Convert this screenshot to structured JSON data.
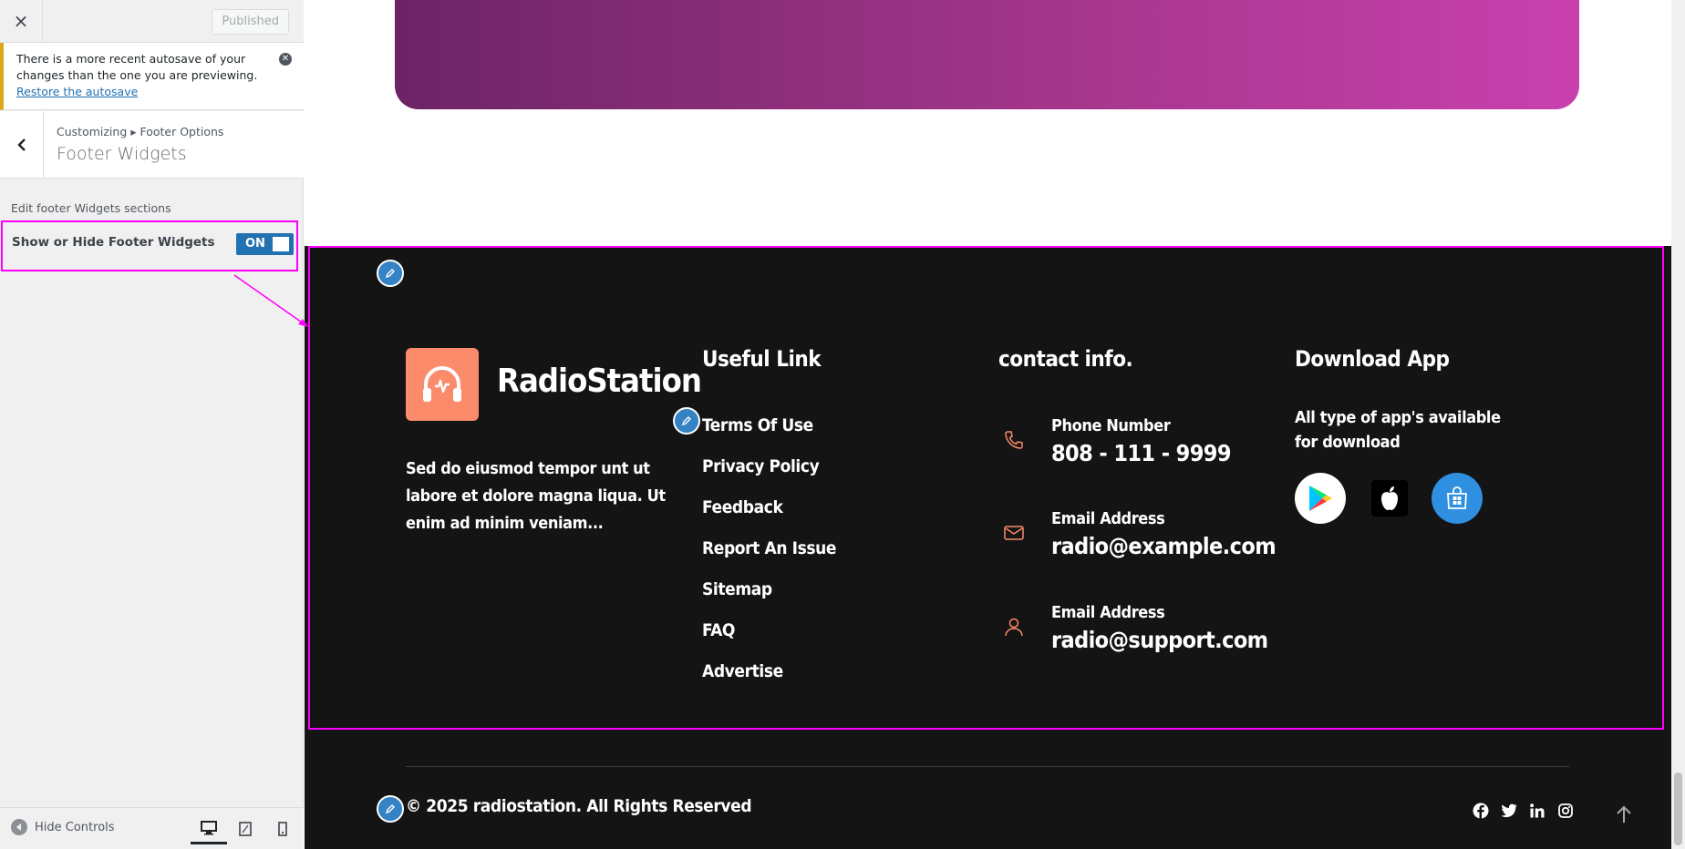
{
  "customizer": {
    "close_label": "×",
    "publish_label": "Published",
    "notice": {
      "text": "There is a more recent autosave of your changes than the one you are previewing.",
      "link": "Restore the autosave"
    },
    "breadcrumb": "Customizing ▸ Footer Options",
    "section_title": "Footer Widgets",
    "section_description": "Edit footer Widgets sections",
    "control": {
      "label": "Show or Hide Footer Widgets",
      "toggle_state": "ON"
    },
    "hide_controls_label": "Hide Controls",
    "devices": [
      "desktop",
      "tablet",
      "mobile"
    ],
    "accent_color": "#2271b1",
    "highlight_color": "#ff00ff"
  },
  "site_footer": {
    "brand": {
      "name": "RadioStation",
      "logo_icon": "headphones-icon",
      "logo_color": "#fb8b6b",
      "about": "Sed do eiusmod tempor unt ut labore et dolore magna liqua. Ut enim ad minim veniam..."
    },
    "useful_links": {
      "title": "Useful Link",
      "items": [
        "Terms Of Use",
        "Privacy Policy",
        "Feedback",
        "Report An Issue",
        "Sitemap",
        "FAQ",
        "Advertise"
      ]
    },
    "contact": {
      "title": "contact info.",
      "items": [
        {
          "icon": "phone-icon",
          "label": "Phone Number",
          "value": "808 - 111 - 9999"
        },
        {
          "icon": "mail-icon",
          "label": "Email Address",
          "value": "radio@example.com"
        },
        {
          "icon": "user-icon",
          "label": "Email Address",
          "value": "radio@support.com"
        }
      ]
    },
    "download_app": {
      "title": "Download App",
      "text": "All type of app's available for download",
      "stores": [
        "google-play-icon",
        "apple-icon",
        "microsoft-store-icon"
      ]
    },
    "copyright": "© 2025 radiostation. All Rights Reserved",
    "social": [
      "facebook-icon",
      "twitter-icon",
      "linkedin-icon",
      "instagram-icon"
    ],
    "background_color": "#141414",
    "accent_color": "#fb8b6b"
  }
}
